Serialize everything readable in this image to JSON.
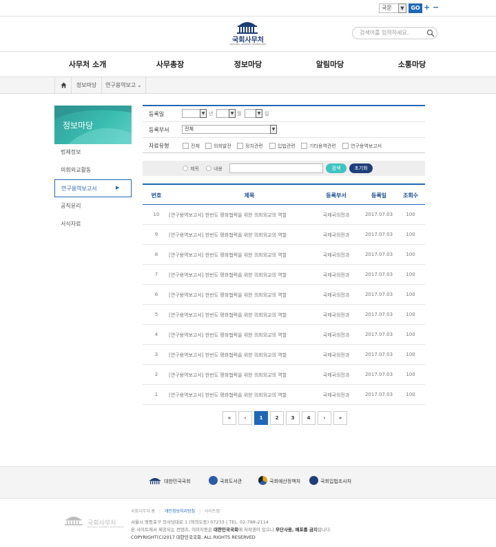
{
  "top": {
    "lang_value": "국문",
    "go_label": "GO",
    "zoom_in": "+",
    "zoom_out": "−"
  },
  "header": {
    "logo_text": "국회사무처",
    "logo_sub": "NATIONAL ASSEMBLY SECRETARIAT",
    "search_placeholder": "검색어를 입력하세요."
  },
  "gnb": [
    "사무처 소개",
    "사무총장",
    "정보마당",
    "알림마당",
    "소통마당"
  ],
  "breadcrumb": {
    "level1": "정보마당",
    "level2": "연구용역보고"
  },
  "lnb": {
    "title": "정보마당",
    "items": [
      "법제정보",
      "의회외교활동",
      "연구용역보고서",
      "공직윤리",
      "서식자료"
    ],
    "active_index": 2
  },
  "filter": {
    "reg_date_label": "등록일",
    "unit_year": "년",
    "unit_month": "월",
    "unit_day": "일",
    "dept_label": "등록부서",
    "dept_value": "전체",
    "type_label": "자료유형",
    "types": [
      "전체",
      "의회발전",
      "정치관련",
      "입법관련",
      "기타용역관련",
      "연구용역보고서"
    ]
  },
  "keyword": {
    "opt_title": "제목",
    "opt_content": "내용",
    "search_btn": "검색",
    "reset_btn": "초기화"
  },
  "table": {
    "headers": [
      "번호",
      "제목",
      "등록부서",
      "등록일",
      "조회수"
    ],
    "rows": [
      {
        "no": "10",
        "title": "[연구용역보고서] 한반도 평화협력을 위한 의회외교의 역할",
        "dept": "국제국의전과",
        "date": "2017.07.03",
        "views": "100"
      },
      {
        "no": "9",
        "title": "[연구용역보고서] 한반도 평화협력을 위한 의회외교의 역할",
        "dept": "국제국의전과",
        "date": "2017.07.03",
        "views": "100"
      },
      {
        "no": "8",
        "title": "[연구용역보고서] 한반도 평화협력을 위한 의회외교의 역할",
        "dept": "국제국의전과",
        "date": "2017.07.03",
        "views": "100"
      },
      {
        "no": "7",
        "title": "[연구용역보고서] 한반도 평화협력을 위한 의회외교의 역할",
        "dept": "국제국의전과",
        "date": "2017.07.03",
        "views": "100"
      },
      {
        "no": "6",
        "title": "[연구용역보고서] 한반도 평화협력을 위한 의회외교의 역할",
        "dept": "국제국의전과",
        "date": "2017.07.03",
        "views": "100"
      },
      {
        "no": "5",
        "title": "[연구용역보고서] 한반도 평화협력을 위한 의회외교의 역할",
        "dept": "국제국의전과",
        "date": "2017.07.03",
        "views": "100"
      },
      {
        "no": "4",
        "title": "[연구용역보고서] 한반도 평화협력을 위한 의회외교의 역할",
        "dept": "국제국의전과",
        "date": "2017.07.03",
        "views": "100"
      },
      {
        "no": "3",
        "title": "[연구용역보고서] 한반도 평화협력을 위한 의회외교의 역할",
        "dept": "국제국의전과",
        "date": "2017.07.03",
        "views": "100"
      },
      {
        "no": "2",
        "title": "[연구용역보고서] 한반도 평화협력을 위한 의회외교의 역할",
        "dept": "국제국의전과",
        "date": "2017.07.03",
        "views": "100"
      },
      {
        "no": "1",
        "title": "[연구용역보고서] 한반도 평화협력을 위한 의회외교의 역할",
        "dept": "국제국의전과",
        "date": "2017.07.03",
        "views": "100"
      }
    ]
  },
  "pagination": {
    "first": "«",
    "prev": "‹",
    "pages": [
      "1",
      "2",
      "3",
      "4"
    ],
    "current": "1",
    "next": "›",
    "last": "»"
  },
  "footer": {
    "orgs": [
      "대한민국국회",
      "국회도서관",
      "국회예산정책처",
      "국회입법조사처"
    ],
    "links": [
      "국회사무처 홈",
      "개인정보처리방침",
      "사이트맵"
    ],
    "logo_text": "국회사무처",
    "logo_sub": "NATIONAL ASSEMBLY SECRETARIAT",
    "address": "서울시 영등포구 의사당대로 1 (여의도동) 07233  |  TEL. 02-788-2114",
    "notice_prefix": "본 사이트에서 제공되는 컨텐츠, 이미지등은 ",
    "notice_owner": "대한민국국회",
    "notice_mid": "에 저작권이 있으니 ",
    "notice_strong": "무단사용, 배포를 금지",
    "notice_suffix": "합니다.",
    "copyright": "COPYRIGHT(C)2017 대한민국국회.  ALL RIGHTS RESERVED"
  },
  "colors": {
    "primary": "#1f68b5",
    "teal": "#3fc4c0",
    "navy": "#1f3f7a"
  }
}
